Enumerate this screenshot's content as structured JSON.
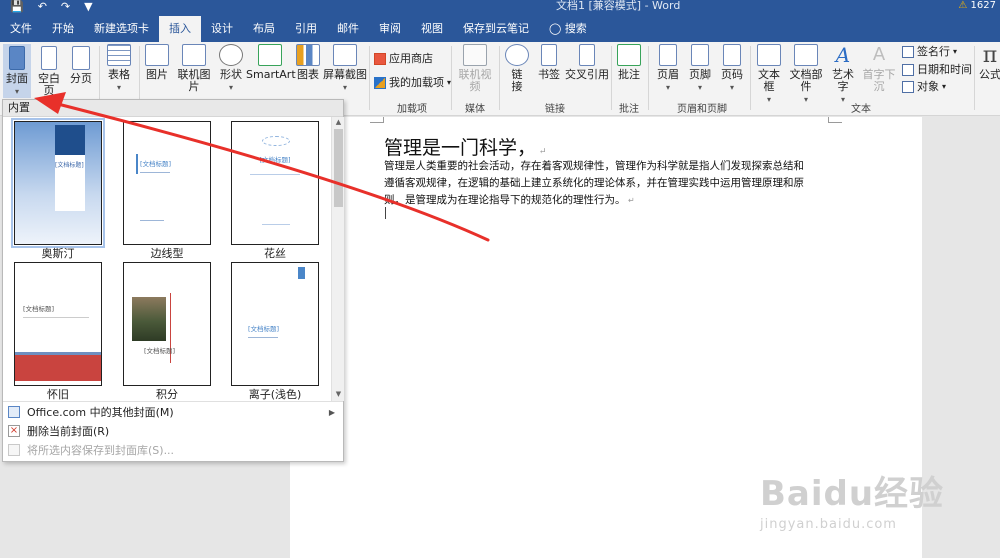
{
  "titlebar": {
    "doc_title": "文档1 [兼容模式] - Word",
    "user": "1627",
    "quick_access": [
      "save-icon",
      "undo-icon",
      "redo-icon",
      "customize-icon"
    ]
  },
  "tabs": [
    {
      "label": "文件"
    },
    {
      "label": "开始"
    },
    {
      "label": "新建选项卡"
    },
    {
      "label": "插入"
    },
    {
      "label": "设计"
    },
    {
      "label": "布局"
    },
    {
      "label": "引用"
    },
    {
      "label": "邮件"
    },
    {
      "label": "审阅"
    },
    {
      "label": "视图"
    },
    {
      "label": "保存到云笔记"
    },
    {
      "label": "搜索"
    }
  ],
  "ribbon": {
    "cover": "封面",
    "blank_page": "空白页",
    "page_break": "分页",
    "table": "表格",
    "picture": "图片",
    "online_picture": "联机图片",
    "shapes": "形状",
    "smartart": "SmartArt",
    "chart": "图表",
    "screenshot": "屏幕截图",
    "app_store": "应用商店",
    "my_addins": "我的加载项",
    "online_video": "联机视频",
    "link": "链",
    "link2": "接",
    "bookmark": "书签",
    "cross_ref": "交叉引用",
    "comment": "批注",
    "header": "页眉",
    "footer": "页脚",
    "page_number": "页码",
    "text_box": "文本框",
    "doc_parts": "文档部件",
    "wordart": "艺术字",
    "drop_cap": "首字下沉",
    "signature": "签名行",
    "datetime": "日期和时间",
    "object": "对象",
    "equation": "公式",
    "groups": {
      "addins": "加载项",
      "media": "媒体",
      "links": "链接",
      "comments": "批注",
      "header_footer": "页眉和页脚",
      "text": "文本"
    }
  },
  "gallery": {
    "header": "内置",
    "thumbs": [
      {
        "label": "奥斯汀",
        "placeholder": "[文档标题]"
      },
      {
        "label": "边线型",
        "placeholder": "[文档标题]"
      },
      {
        "label": "花丝",
        "placeholder": "[文档标题]"
      },
      {
        "label": "怀旧",
        "placeholder": "[文档标题]"
      },
      {
        "label": "积分",
        "placeholder": "[文档标题]"
      },
      {
        "label": "离子(浅色)",
        "placeholder": "[文档标题]"
      }
    ],
    "menu": {
      "more_covers": "Office.com 中的其他封面(M)",
      "remove_cover": "删除当前封面(R)",
      "save_selection": "将所选内容保存到封面库(S)..."
    }
  },
  "document": {
    "heading": "管理是一门科学，",
    "paragraph_lines": [
      "管理是人类重要的社会活动，存在着客观规律性，管理作为科学就是指人们发现探索总结和",
      "遵循客观规律，在逻辑的基础上建立系统化的理论体系，并在管理实践中运用管理原理和原",
      "则，是管理成为在理论指导下的规范化的理性行为。"
    ]
  },
  "watermark": {
    "brand": "Baidu经验",
    "url": "jingyan.baidu.com"
  },
  "colors": {
    "ribbon_blue": "#2b579a",
    "annotation_red": "#e8302a"
  }
}
